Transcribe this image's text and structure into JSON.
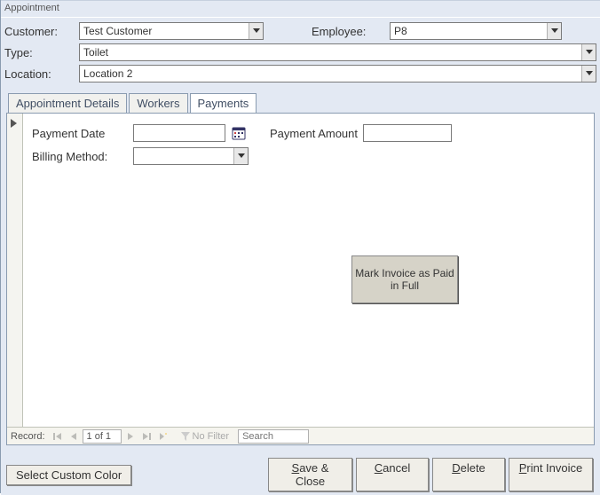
{
  "window": {
    "title": "Appointment"
  },
  "form": {
    "customer_label": "Customer:",
    "customer_value": "Test Customer",
    "employee_label": "Employee:",
    "employee_value": "P8",
    "type_label": "Type:",
    "type_value": "Toilet",
    "location_label": "Location:",
    "location_value": "Location 2"
  },
  "tabs": {
    "details": "Appointment Details",
    "workers": "Workers",
    "payments": "Payments"
  },
  "payments": {
    "payment_date_label": "Payment Date",
    "payment_date_value": "",
    "payment_amount_label": "Payment Amount",
    "payment_amount_value": "",
    "billing_method_label": "Billing Method:",
    "billing_method_value": "",
    "mark_paid_button": "Mark Invoice as Paid in Full"
  },
  "nav": {
    "record_label": "Record:",
    "position": "1 of 1",
    "no_filter": "No Filter",
    "search_placeholder": "Search"
  },
  "buttons": {
    "select_color": "Select Custom Color",
    "save_close_pre": "S",
    "save_close_post": "ave & Close",
    "cancel_pre": "C",
    "cancel_post": "ancel",
    "delete_pre": "D",
    "delete_post": "elete",
    "print_pre": "P",
    "print_post": "rint Invoice"
  }
}
